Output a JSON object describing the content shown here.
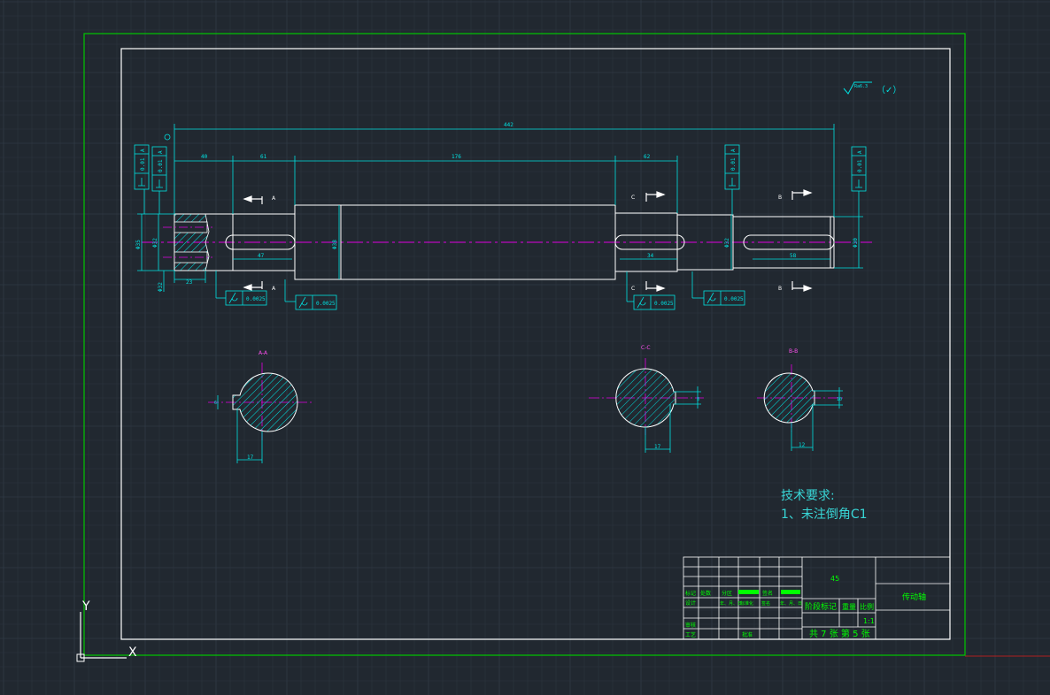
{
  "colors": {
    "background": "#212830",
    "grid": "#2d3540",
    "grid_major": "#36404c",
    "paper_border": "#00c800",
    "frame": "#ffffff",
    "dimension": "#00e0e0",
    "centerline": "#e000e0",
    "title_block_text": "#00ff00",
    "tech_text": "#38d6d6"
  },
  "drawing": {
    "overall_length": "442",
    "seg_left": "40",
    "seg_a": "61",
    "seg_mid": "176",
    "seg_right": "62",
    "len_key_left": "47",
    "len_key_mid": "34",
    "len_key_right": "58",
    "len_23": "23",
    "dia_main": "Φ38",
    "dia_left": "Φ35",
    "dia_left2": "Φ32",
    "dia_right": "Φ35",
    "dia_right2": "Φ30",
    "dia_mid2": "Φ32",
    "dia_bottom": "Φ32",
    "tol_left_1": "0.01",
    "tol_left_2": "0.01",
    "tol_right_1": "0.01",
    "tol_right_2": "0.01",
    "datum": "A",
    "cyl_1": "0.0025",
    "cyl_2": "0.0025",
    "cyl_3": "0.0025",
    "cyl_4": "0.0025",
    "section_a": "A",
    "section_b": "B",
    "section_c": "C",
    "view_aa": "A-A",
    "view_cc": "C-C",
    "view_bb": "B-B",
    "sec_dim_1": "17",
    "sec_dim_2": "17",
    "sec_dim_3": "12",
    "sec_small_1": "6",
    "sec_small_2": "8",
    "sec_small_3": "10",
    "roughness": "Ra6.3",
    "roughness_other": "（✓）"
  },
  "tech_requirements": {
    "title": "技术要求:",
    "item1": "1、未注倒角C1"
  },
  "title_block": {
    "material": "45",
    "part_name": "传动轴",
    "scale": "1:1",
    "sheet_info": "共 7 张 第 5 张",
    "stage_mark": "阶段标记",
    "weight": "重量",
    "scale_label": "比例",
    "row_labels": [
      "标记",
      "处数",
      "分区",
      "更改文件号",
      "签名",
      "年月日"
    ],
    "labels_a": [
      "标记",
      "处数",
      "分区",
      "",
      "签名",
      ""
    ],
    "labels_b": [
      "设计",
      "",
      "年、月、日",
      "标准化",
      "签名",
      "年、月、日"
    ],
    "labels_c": [
      "审核",
      "",
      "",
      "",
      "",
      ""
    ],
    "labels_d": [
      "工艺",
      "",
      "",
      "批准",
      "",
      ""
    ]
  },
  "ucs": {
    "y_label": "Y",
    "x_label": "X"
  }
}
